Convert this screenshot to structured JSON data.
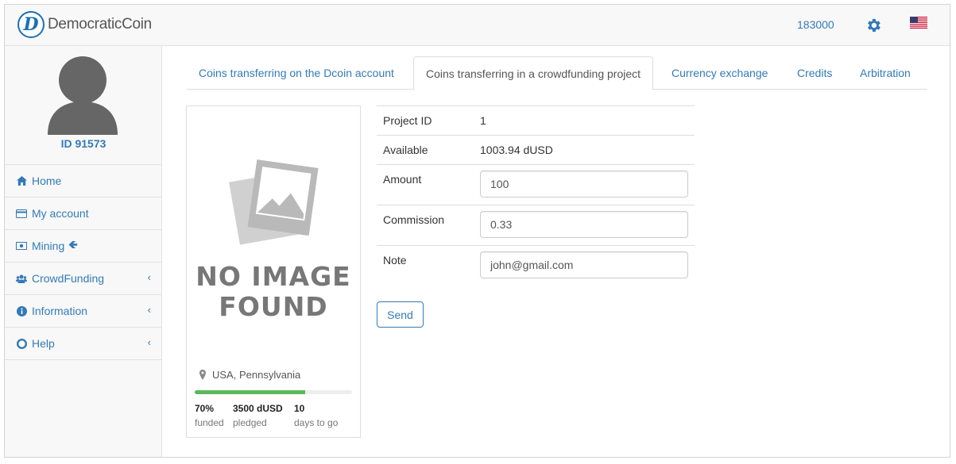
{
  "header": {
    "logo_letter": "D",
    "app_name": "DemocraticCoin",
    "balance": "183000",
    "settings_icon": "gear-icon",
    "language_icon": "us-flag-icon"
  },
  "sidebar": {
    "user_id": "ID 91573",
    "items": [
      {
        "label": "Home",
        "icon": "home-icon"
      },
      {
        "label": "My account",
        "icon": "credit-card-icon"
      },
      {
        "label": "Mining",
        "icon": "money-icon",
        "suffix_icon": "arrow-left-icon"
      },
      {
        "label": "CrowdFunding",
        "icon": "users-icon",
        "chevron": "‹"
      },
      {
        "label": "Information",
        "icon": "info-icon",
        "chevron": "‹"
      },
      {
        "label": "Help",
        "icon": "life-ring-icon",
        "chevron": "‹"
      }
    ]
  },
  "tabs": [
    {
      "label": "Coins transferring on the Dcoin account",
      "active": false
    },
    {
      "label": "Coins transferring in a crowdfunding project",
      "active": true
    },
    {
      "label": "Currency exchange",
      "active": false
    },
    {
      "label": "Credits",
      "active": false
    },
    {
      "label": "Arbitration",
      "active": false
    }
  ],
  "project_card": {
    "image_text_line1": "NO IMAGE",
    "image_text_line2": "FOUND",
    "location": "USA, Pennsylvania",
    "progress_percent": 70,
    "funded_value": "70%",
    "funded_label": "funded",
    "pledged_value": "3500 dUSD",
    "pledged_label": "pledged",
    "days_value": "10",
    "days_label": "days to go"
  },
  "form": {
    "project_id_label": "Project ID",
    "project_id_value": "1",
    "available_label": "Available",
    "available_value": "1003.94 dUSD",
    "amount_label": "Amount",
    "amount_value": "100",
    "commission_label": "Commission",
    "commission_value": "0.33",
    "note_label": "Note",
    "note_value": "john@gmail.com",
    "send_label": "Send"
  },
  "colors": {
    "link": "#337ab7",
    "progress": "#5cb85c",
    "border": "#dddddd"
  }
}
